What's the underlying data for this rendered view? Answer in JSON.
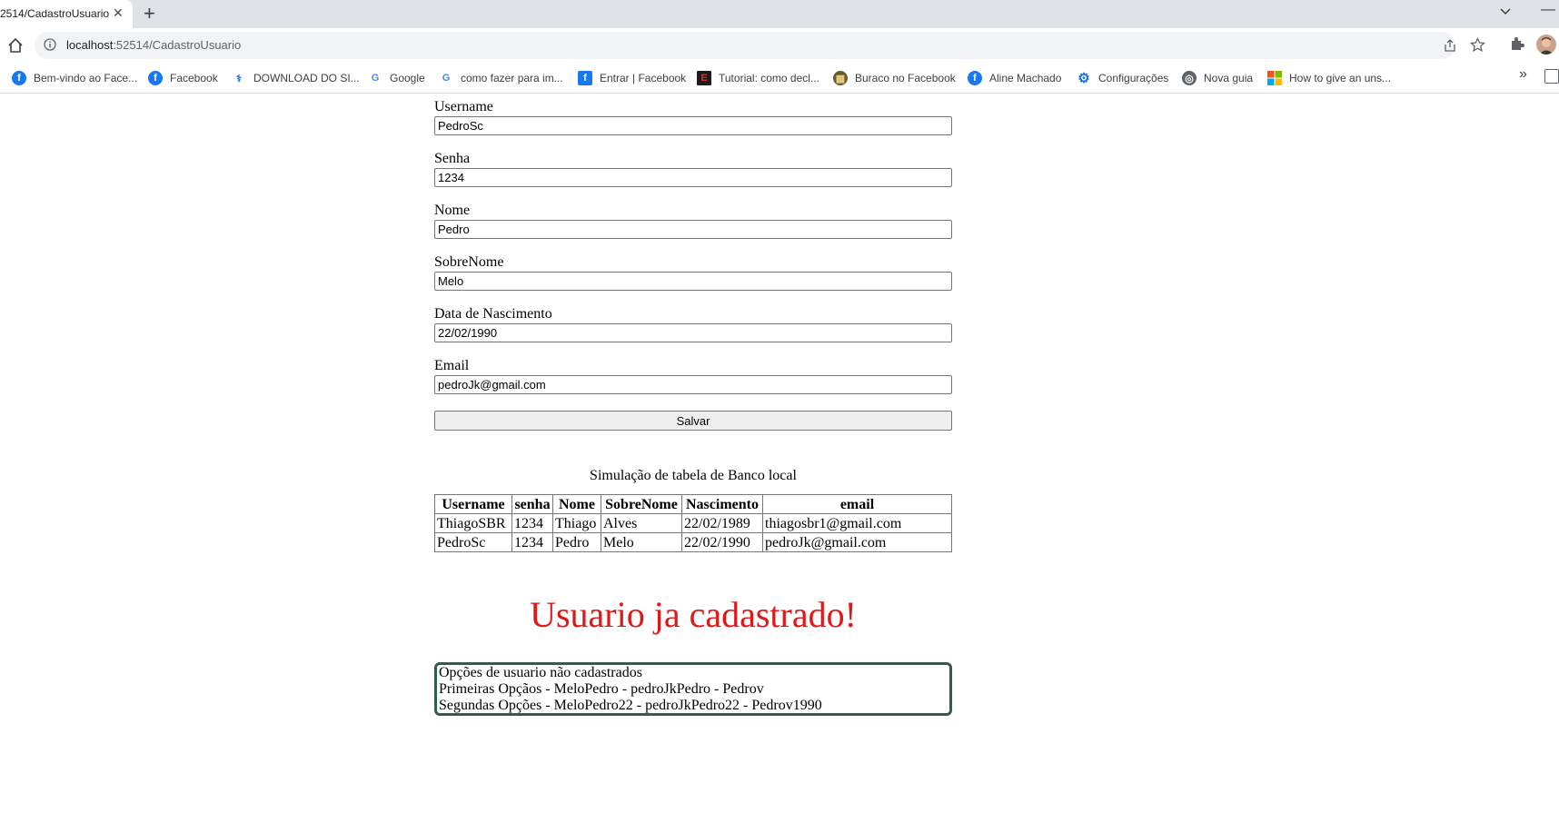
{
  "browser": {
    "tab_title": "2514/CadastroUsuario",
    "url_host": "localhost",
    "url_rest": ":52514/CadastroUsuario",
    "bookmarks": [
      {
        "label": "Bem-vindo ao Face...",
        "icon": "facebook-icon"
      },
      {
        "label": "Facebook",
        "icon": "facebook-icon"
      },
      {
        "label": "DOWNLOAD DO SI...",
        "icon": "download-icon"
      },
      {
        "label": "Google",
        "icon": "google-icon"
      },
      {
        "label": "como fazer para im...",
        "icon": "google-icon"
      },
      {
        "label": "Entrar | Facebook",
        "icon": "facebook-square-icon"
      },
      {
        "label": "Tutorial: como decl...",
        "icon": "e-icon"
      },
      {
        "label": "Buraco no Facebook",
        "icon": "cards-icon"
      },
      {
        "label": "Aline Machado",
        "icon": "facebook-icon"
      },
      {
        "label": "Configurações",
        "icon": "gear-icon"
      },
      {
        "label": "Nova guia",
        "icon": "globe-icon"
      },
      {
        "label": "How to give an uns...",
        "icon": "microsoft-icon"
      }
    ]
  },
  "form": {
    "fields": [
      {
        "label": "Username",
        "value": "PedroSc"
      },
      {
        "label": "Senha",
        "value": "1234"
      },
      {
        "label": "Nome",
        "value": "Pedro"
      },
      {
        "label": "SobreNome",
        "value": "Melo"
      },
      {
        "label": "Data de Nascimento",
        "value": "22/02/1990"
      },
      {
        "label": "Email",
        "value": "pedroJk@gmail.com"
      }
    ],
    "save_label": "Salvar"
  },
  "table": {
    "caption": "Simulação de tabela de Banco local",
    "headers": [
      "Username",
      "senha",
      "Nome",
      "SobreNome",
      "Nascimento",
      "email"
    ],
    "rows": [
      [
        "ThiagoSBR",
        "1234",
        "Thiago",
        "Alves",
        "22/02/1989",
        "thiagosbr1@gmail.com"
      ],
      [
        "PedroSc",
        "1234",
        "Pedro",
        "Melo",
        "22/02/1990",
        "pedroJk@gmail.com"
      ]
    ]
  },
  "error_message": "Usuario ja cadastrado!",
  "options": {
    "title": "Opções de usuario não cadastrados",
    "first": "Primeiras Opçãos - MeloPedro - pedroJkPedro - Pedrov",
    "second": "Segundas Opções - MeloPedro22 - pedroJkPedro22 - Pedrov1990"
  }
}
